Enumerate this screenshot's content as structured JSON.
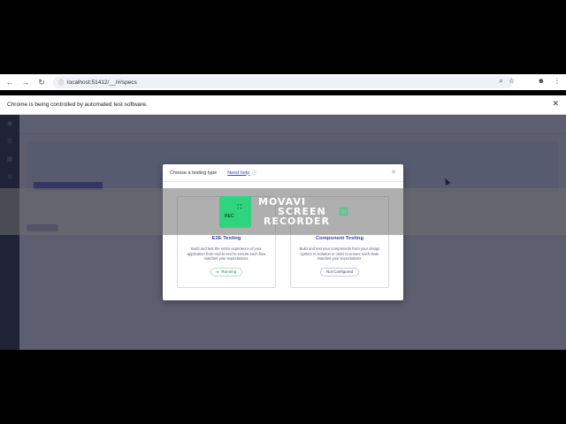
{
  "browser": {
    "url": "localhost:51412/__/#/specs",
    "infobar_message": "Chrome is being controlled by automated test software."
  },
  "modal": {
    "title": "Choose a testing type",
    "help_link": "Need help",
    "cards": [
      {
        "title": "E2E Testing",
        "description": "Build and test the entire experience of your application from end-to-end to ensure each flow matches your expectations.",
        "status": "Running"
      },
      {
        "title": "Component Testing",
        "description": "Build and test your components from your design system in isolation in order to ensure each state matches your expectations.",
        "status": "Not Configured"
      }
    ]
  },
  "watermark": {
    "line1": "MOVAVI",
    "line2": "SCREEN",
    "line3": "RECORDER",
    "logo_badge": "REC"
  },
  "colors": {
    "accent": "#3843a3",
    "running": "#1fa45a",
    "watermark_green": "#2fd47e",
    "sidebar": "#1b1e2e"
  }
}
